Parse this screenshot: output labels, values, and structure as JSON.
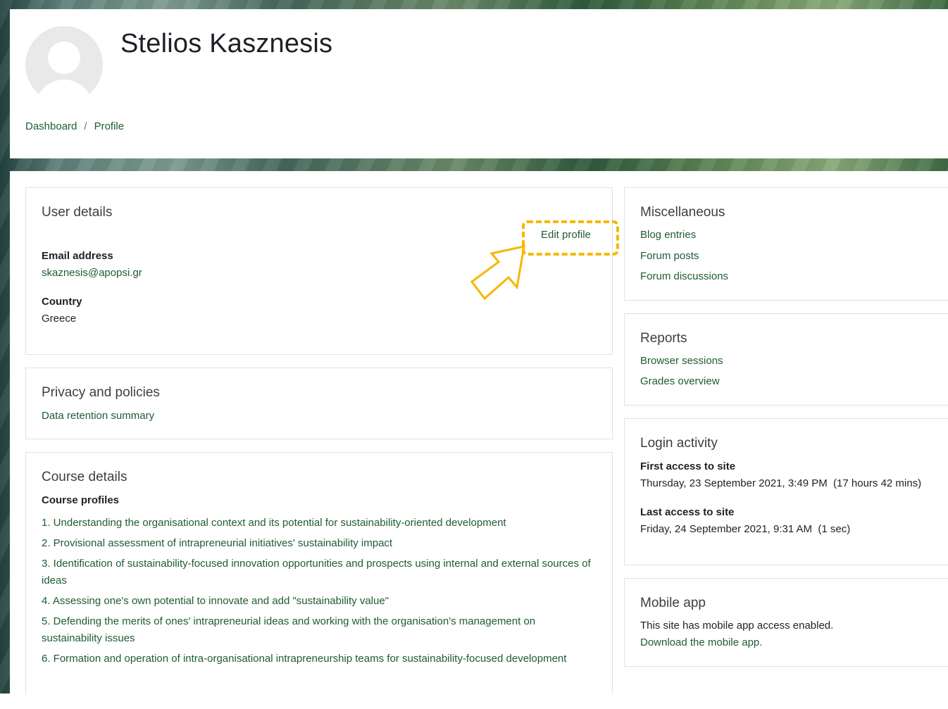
{
  "user": {
    "full_name": "Stelios Kasznesis"
  },
  "breadcrumb": {
    "items": [
      "Dashboard",
      "Profile"
    ],
    "separator": "/"
  },
  "user_details": {
    "title": "User details",
    "edit_profile": "Edit profile",
    "email_label": "Email address",
    "email_value": "skaznesis@apopsi.gr",
    "country_label": "Country",
    "country_value": "Greece"
  },
  "privacy": {
    "title": "Privacy and policies",
    "data_retention": "Data retention summary"
  },
  "course_details": {
    "title": "Course details",
    "subtitle": "Course profiles",
    "courses": [
      "1. Understanding the organisational context and its potential for sustainability-oriented development",
      "2. Provisional assessment of intrapreneurial initiatives' sustainability impact",
      "3. Identification of sustainability-focused innovation opportunities and prospects using internal and external sources of ideas",
      "4. Assessing one's own potential to innovate and add \"sustainability value\"",
      "5. Defending the merits of ones' intrapreneurial ideas and working with the organisation's management on sustainability issues",
      "6. Formation and operation of intra-organisational intrapreneurship teams for sustainability-focused development"
    ]
  },
  "miscellaneous": {
    "title": "Miscellaneous",
    "links": [
      "Blog entries",
      "Forum posts",
      "Forum discussions"
    ]
  },
  "reports": {
    "title": "Reports",
    "links": [
      "Browser sessions",
      "Grades overview"
    ]
  },
  "login_activity": {
    "title": "Login activity",
    "first_label": "First access to site",
    "first_value": "Thursday, 23 September 2021, 3:49 PM  (17 hours 42 mins)",
    "last_label": "Last access to site",
    "last_value": "Friday, 24 September 2021, 9:31 AM  (1 sec)"
  },
  "mobile_app": {
    "title": "Mobile app",
    "text": "This site has mobile app access enabled.",
    "download": "Download the mobile app."
  },
  "colors": {
    "link": "#1f5b33",
    "highlight": "#f5b800",
    "border": "#dee2e6"
  }
}
